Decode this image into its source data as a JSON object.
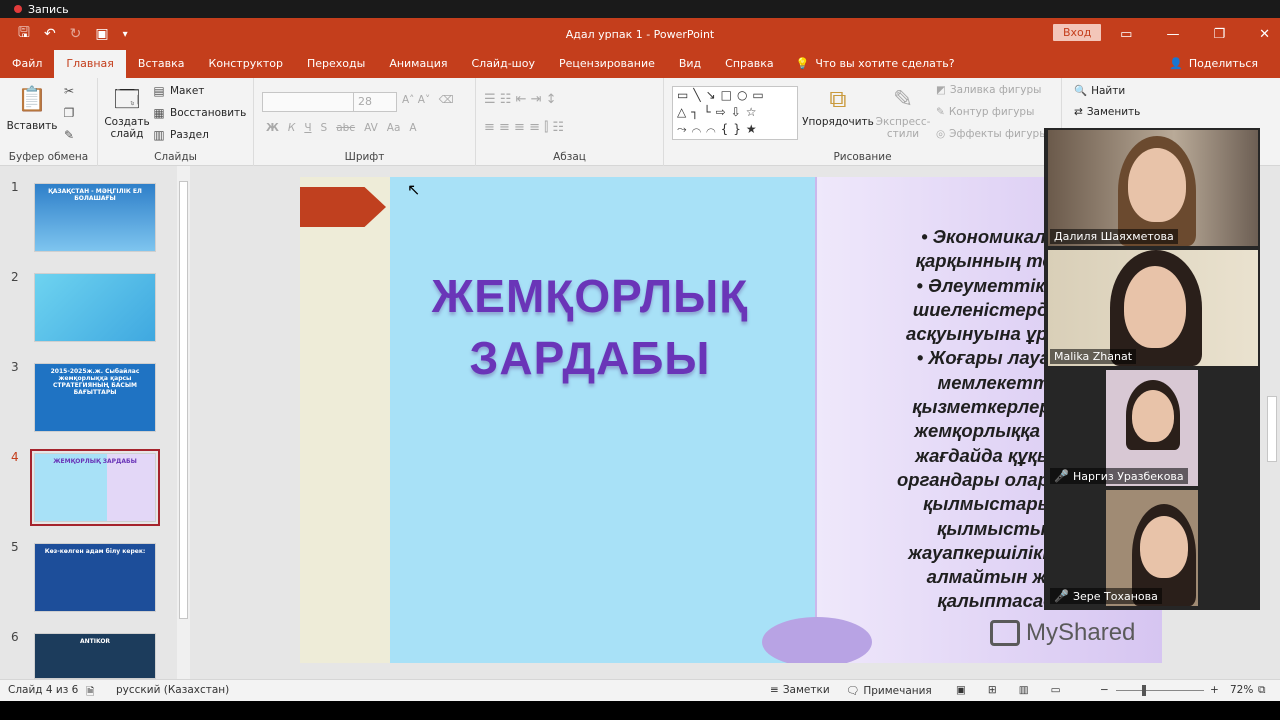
{
  "recording": {
    "label": "Запись"
  },
  "window": {
    "title": "Адал урпак 1  -  PowerPoint",
    "signin_label": "Вход",
    "share_label": "Поделиться"
  },
  "tabs": [
    {
      "label": "Файл"
    },
    {
      "label": "Главная"
    },
    {
      "label": "Вставка"
    },
    {
      "label": "Конструктор"
    },
    {
      "label": "Переходы"
    },
    {
      "label": "Анимация"
    },
    {
      "label": "Слайд-шоу"
    },
    {
      "label": "Рецензирование"
    },
    {
      "label": "Вид"
    },
    {
      "label": "Справка"
    }
  ],
  "tell_me": "Что вы хотите сделать?",
  "ribbon": {
    "clipboard": {
      "label": "Буфер обмена",
      "paste": "Вставить"
    },
    "slides": {
      "label": "Слайды",
      "new_slide_1": "Создать",
      "new_slide_2": "слайд",
      "layout": "Макет",
      "reset": "Восстановить",
      "section": "Раздел"
    },
    "font": {
      "label": "Шрифт",
      "size": "28"
    },
    "paragraph": {
      "label": "Абзац"
    },
    "drawing": {
      "label": "Рисование",
      "arrange": "Упорядочить",
      "quick_styles_1": "Экспресс-",
      "quick_styles_2": "стили",
      "fill": "Заливка фигуры",
      "outline": "Контур фигуры",
      "effects": "Эффекты фигуры"
    },
    "editing": {
      "find": "Найти",
      "replace": "Заменить"
    }
  },
  "slides": [
    {
      "num": "1",
      "text": "ҚАЗАҚСТАН - МӘҢГІЛІК ЕЛ БОЛАШАҒЫ"
    },
    {
      "num": "2",
      "text": ""
    },
    {
      "num": "3",
      "text": "2015-2025ж.ж. Сыбайлас жемқорлыққа қарсы СТРАТЕГИЯНЫҢ БАСЫМ БАҒЫТТАРЫ"
    },
    {
      "num": "4",
      "text": "ЖЕМҚОРЛЫҚ ЗАРДАБЫ"
    },
    {
      "num": "5",
      "text": "Көз-көлген адам білу керек:"
    },
    {
      "num": "6",
      "text": "ANTIKOR"
    }
  ],
  "current_slide": {
    "title_line1": "ЖЕМҚОРЛЫҚ",
    "title_line2": "ЗАРДАБЫ",
    "body_lines": [
      "•  Экономикалық",
      "қарқынның теже",
      "•  Әлеуметтік, са",
      "шиеленістердің к",
      "асқуынуына ұрынд",
      "•  Жоғары лауазы",
      "мемлекетті",
      "қызметкерлер же",
      "жемқорлыққа сал",
      "жағдайда құқық к",
      "органдары оларды ж",
      "қылмыстары ү",
      "қылмыстық",
      "жауапкершілікке т",
      "алмайтын жағ",
      "қалыптасад"
    ],
    "watermark": "MyShared"
  },
  "participants": [
    {
      "name": "Далиля Шаяхметова",
      "muted": false
    },
    {
      "name": "Malika Zhanat",
      "muted": false
    },
    {
      "name": "Наргиз Уразбекова",
      "muted": true
    },
    {
      "name": "Зере Тоханова",
      "muted": true
    }
  ],
  "status": {
    "slide_info": "Слайд 4 из 6",
    "language": "русский (Казахстан)",
    "notes": "Заметки",
    "comments": "Примечания",
    "zoom": "72%"
  }
}
